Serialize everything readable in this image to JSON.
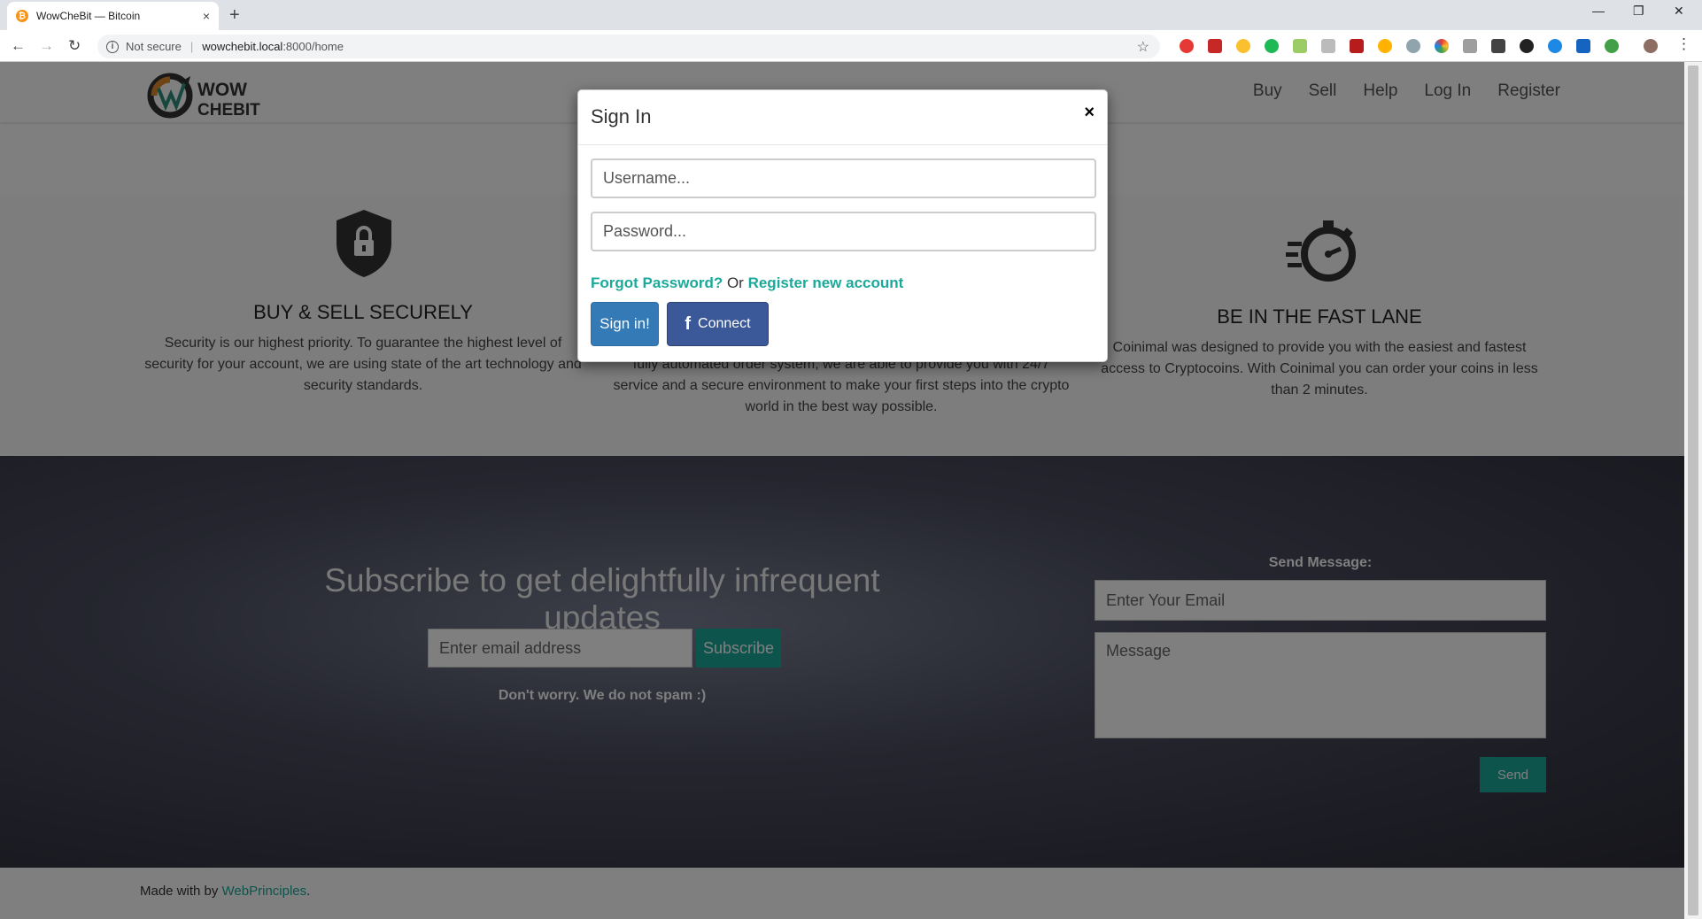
{
  "browser": {
    "tab_title": "WowCheBit — Bitcoin",
    "tab_close": "×",
    "new_tab": "+",
    "security_label": "Not secure",
    "url_host": "wowchebit.local",
    "url_path": ":8000/home"
  },
  "nav": {
    "items": [
      "Buy",
      "Sell",
      "Help",
      "Log In",
      "Register"
    ]
  },
  "features": [
    {
      "title": "BUY & SELL SECURELY",
      "text": "Security is our highest priority. To guarantee the highest level of security for your account, we are using state of the art technology and security standards."
    },
    {
      "title": "",
      "text": "fully automated order system, we are able to provide you with 24/7 service and a secure environment to make your first steps into the crypto world in the best way possible."
    },
    {
      "title": "BE IN THE FAST LANE",
      "text": "Coinimal was designed to provide you with the easiest and fastest access to Cryptocoins. With Coinimal you can order your coins in less than 2 minutes."
    }
  ],
  "subscribe": {
    "title": "Subscribe to get delightfully infrequent updates",
    "email_placeholder": "Enter email address",
    "button": "Subscribe",
    "note": "Don't worry. We do not spam :)"
  },
  "contact": {
    "label": "Send Message:",
    "email_placeholder": "Enter Your Email",
    "message_placeholder": "Message",
    "button": "Send"
  },
  "footer": {
    "prefix": "Made with by ",
    "link": "WebPrinciples",
    "suffix": "."
  },
  "modal": {
    "title": "Sign In",
    "close": "×",
    "username_placeholder": "Username...",
    "password_placeholder": "Password...",
    "forgot": "Forgot Password?",
    "or": " Or ",
    "register": "Register new account",
    "signin_button": "Sign in!",
    "facebook_button": "Connect"
  },
  "colors": {
    "accent": "#1aa99a",
    "primary": "#337ab7",
    "facebook": "#3b5998"
  }
}
